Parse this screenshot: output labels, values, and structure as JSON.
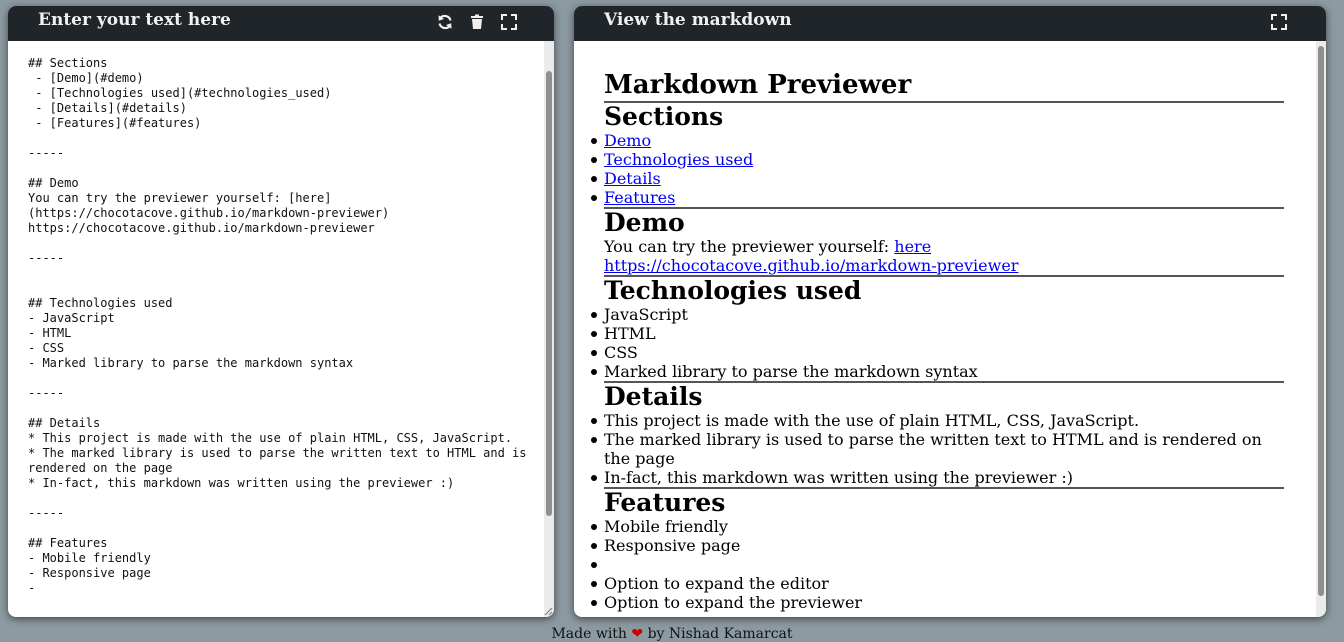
{
  "editor": {
    "title": "Enter your text here",
    "icons": [
      "refresh-icon",
      "trash-icon",
      "expand-icon"
    ],
    "content": "## Sections\n - [Demo](#demo)\n - [Technologies used](#technologies_used)\n - [Details](#details)\n - [Features](#features)\n\n-----\n\n## Demo\nYou can try the previewer yourself: [here](https://chocotacove.github.io/markdown-previewer)\nhttps://chocotacove.github.io/markdown-previewer\n\n-----\n\n\n## Technologies used\n- JavaScript\n- HTML\n- CSS\n- Marked library to parse the markdown syntax\n\n-----\n\n## Details\n* This project is made with the use of plain HTML, CSS, JavaScript.\n* The marked library is used to parse the written text to HTML and is rendered on the page\n* In-fact, this markdown was written using the previewer :)\n\n-----\n\n## Features\n- Mobile friendly\n- Responsive page\n-"
  },
  "preview": {
    "title": "View the markdown",
    "icons": [
      "expand-icon"
    ],
    "heading": "Markdown Previewer",
    "sections_heading": "Sections",
    "section_links": [
      "Demo",
      "Technologies used",
      "Details",
      "Features"
    ],
    "demo_heading": "Demo",
    "demo_text": "You can try the previewer yourself: ",
    "demo_link": "here",
    "demo_url": "https://chocotacove.github.io/markdown-previewer",
    "tech_heading": "Technologies used",
    "tech_items": [
      "JavaScript",
      "HTML",
      "CSS",
      "Marked library to parse the markdown syntax"
    ],
    "details_heading": "Details",
    "details_items": [
      "This project is made with the use of plain HTML, CSS, JavaScript.",
      "The marked library is used to parse the written text to HTML and is rendered on the page",
      "In-fact, this markdown was written using the previewer :)"
    ],
    "features_heading": "Features",
    "features_items": [
      "Mobile friendly",
      "Responsive page",
      "",
      "Option to expand the editor",
      "Option to expand the previewer"
    ]
  },
  "footer": {
    "made_with": "Made with",
    "heart_icon": "heart-icon",
    "by": "by Nishad Kamarcat"
  },
  "colors": {
    "titlebar": "#1f2529",
    "background": "#8c9aa1",
    "link": "#0000ee"
  }
}
